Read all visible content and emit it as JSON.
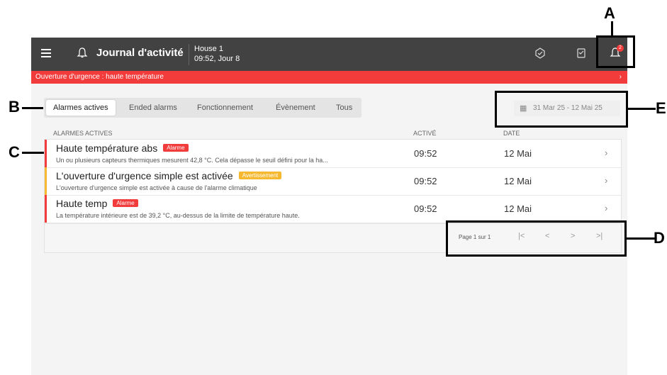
{
  "topbar": {
    "title": "Journal d'activité",
    "house_name": "House 1",
    "house_time": "09:52, Jour 8",
    "notification_count": "2"
  },
  "alert_banner": {
    "text": "Ouverture d'urgence : haute température",
    "chevron": "›"
  },
  "tabs": [
    {
      "label": "Alarmes actives",
      "active": true
    },
    {
      "label": "Ended alarms"
    },
    {
      "label": "Fonctionnement"
    },
    {
      "label": "Évènement"
    },
    {
      "label": "Tous"
    }
  ],
  "date_range": "31 Mar 25 - 12 Mai 25",
  "table": {
    "headers": [
      "ALARMES ACTIVES",
      "ACTIVÉ",
      "DATE"
    ],
    "rows": [
      {
        "title": "Haute température abs",
        "badge": "Alarme",
        "badge_color": "#f23b3b",
        "description": "Un ou plusieurs capteurs thermiques mesurent 42,8 °C. Cela dépasse le seuil défini pour la ha...",
        "activated": "09:52",
        "date": "12 Mai",
        "chevron": "›"
      },
      {
        "title": "L'ouverture d'urgence simple est activée",
        "badge": "Avertissement",
        "badge_color": "#f5b82e",
        "description": "L'ouverture d'urgence simple est activée à cause de l'alarme climatique",
        "activated": "09:52",
        "date": "12 Mai",
        "chevron": "›"
      },
      {
        "title": "Haute temp",
        "badge": "Alarme",
        "badge_color": "#f23b3b",
        "description": "La température intérieure est de 39,2 °C, au-dessus de la limite de température haute.",
        "activated": "09:52",
        "date": "12 Mai",
        "chevron": "›"
      }
    ]
  },
  "pager": {
    "text": "Page 1 sur 1",
    "first": "|<",
    "prev": "<",
    "next": ">",
    "last": ">|"
  },
  "callouts": {
    "a": "A",
    "b": "B",
    "c": "C",
    "d": "D",
    "e": "E"
  },
  "colors": {
    "topbar": "#424242",
    "alert": "#f23b3b",
    "warning": "#f5b82e"
  }
}
